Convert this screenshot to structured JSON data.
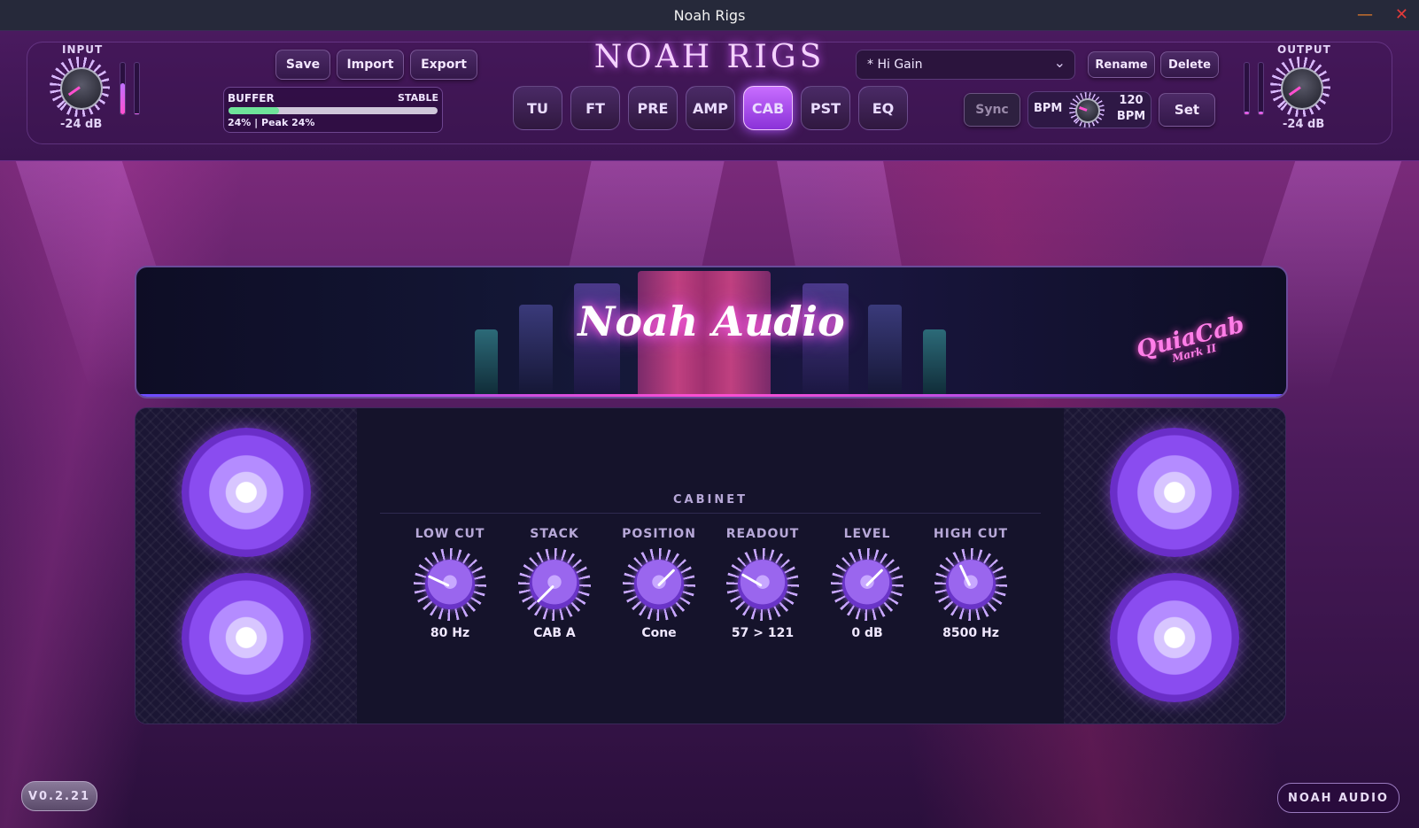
{
  "window": {
    "title": "Noah Rigs"
  },
  "brand": {
    "logo_text": "NOAH RIGS"
  },
  "input": {
    "label": "INPUT",
    "value": "-24 dB",
    "meter_levels": [
      0.6,
      0.0
    ]
  },
  "output": {
    "label": "OUTPUT",
    "value": "-24 dB",
    "meter_levels": [
      0.05,
      0.05
    ]
  },
  "file_buttons": {
    "save": "Save",
    "import": "Import",
    "export": "Export"
  },
  "buffer": {
    "label": "BUFFER",
    "status": "STABLE",
    "readout": "24% | Peak 24%",
    "fill_percent": 24
  },
  "tabs": [
    {
      "label": "TU",
      "active": false
    },
    {
      "label": "FT",
      "active": false
    },
    {
      "label": "PRE",
      "active": false
    },
    {
      "label": "AMP",
      "active": false
    },
    {
      "label": "CAB",
      "active": true
    },
    {
      "label": "PST",
      "active": false
    },
    {
      "label": "EQ",
      "active": false
    }
  ],
  "preset": {
    "selected": "* Hi Gain",
    "rename": "Rename",
    "delete": "Delete"
  },
  "tempo": {
    "sync": "Sync",
    "bpm_label": "BPM",
    "bpm_value": "120",
    "bpm_unit": "BPM",
    "set": "Set"
  },
  "cabinet": {
    "banner_brand": "Noah Audio",
    "banner_model": "QuiaCab",
    "banner_model_sub": "Mark II",
    "section_title": "CABINET",
    "knobs": [
      {
        "label": "LOW CUT",
        "value": "80 Hz",
        "angle": -155
      },
      {
        "label": "STACK",
        "value": "CAB A",
        "angle": 135
      },
      {
        "label": "POSITION",
        "value": "Cone",
        "angle": -45
      },
      {
        "label": "READOUT",
        "value": "57 > 121",
        "angle": -150
      },
      {
        "label": "LEVEL",
        "value": "0 dB",
        "angle": -45
      },
      {
        "label": "HIGH CUT",
        "value": "8500 Hz",
        "angle": -115
      }
    ]
  },
  "footer": {
    "version": "V0.2.21",
    "brand": "NOAH AUDIO"
  },
  "colors": {
    "accent": "#b055ff",
    "pink": "#ff4fd0",
    "background": "#1a0b2e"
  }
}
